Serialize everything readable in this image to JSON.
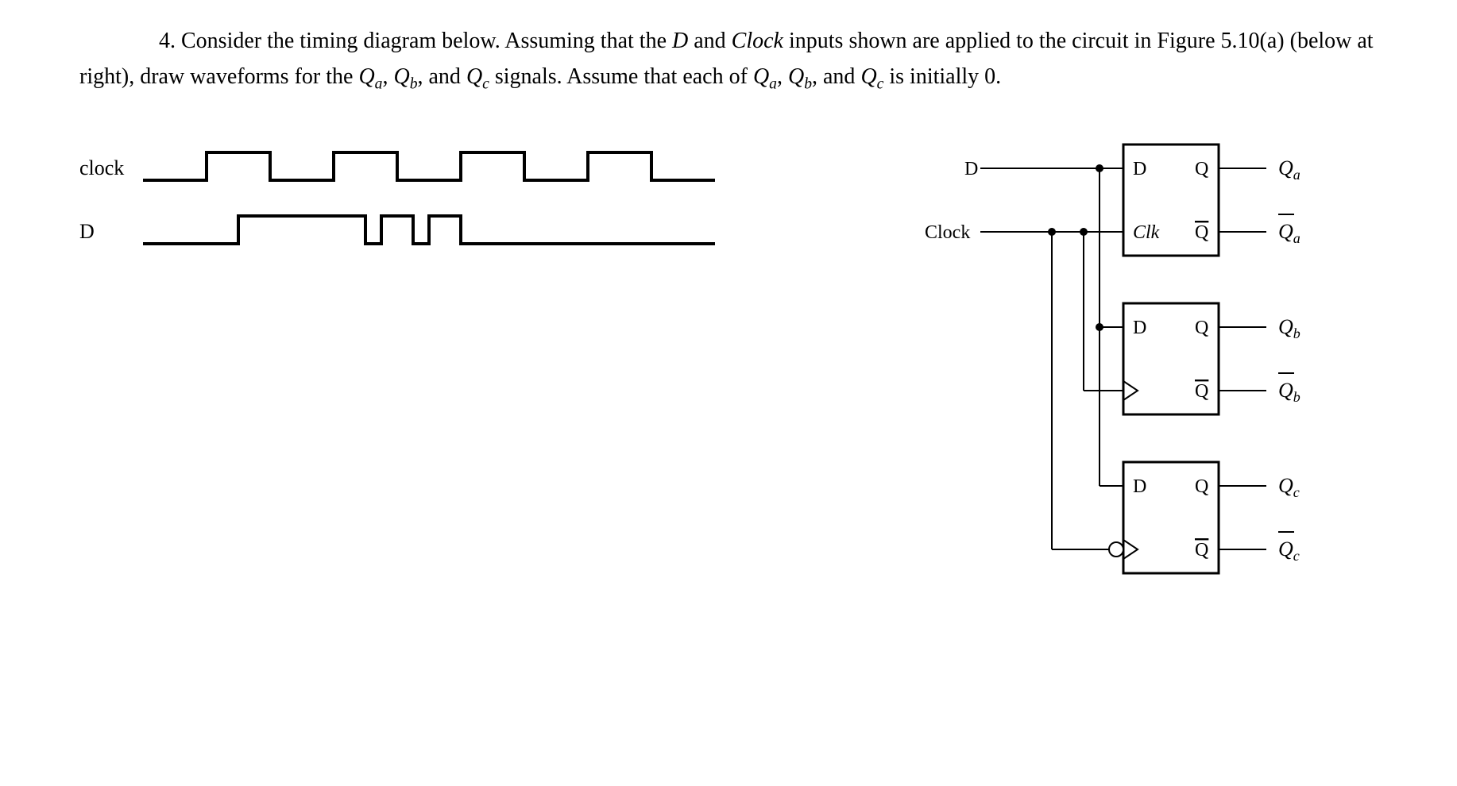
{
  "problem": {
    "number": "4.",
    "text_parts": {
      "p1": "Consider the timing diagram below.  Assuming that the ",
      "D": "D",
      "p2": " and ",
      "Clock": "Clock",
      "p3": " inputs shown are applied to the circuit in Figure 5.10(a) (below at right), draw waveforms for the ",
      "Qa": "Q",
      "a": "a",
      "p4": ", ",
      "Qb": "Q",
      "b": "b",
      "p5": ", and ",
      "Qc": "Q",
      "c": "c",
      "p6": " signals.  Assume that each of ",
      "p7": ", ",
      "p8": ", and ",
      "p9": " is initially 0."
    }
  },
  "timing": {
    "clock_label": "clock",
    "d_label": "D",
    "clock_wave": [
      {
        "t": 0,
        "v": 0
      },
      {
        "t": 80,
        "v": 0
      },
      {
        "t": 80,
        "v": 1
      },
      {
        "t": 160,
        "v": 1
      },
      {
        "t": 160,
        "v": 0
      },
      {
        "t": 240,
        "v": 0
      },
      {
        "t": 240,
        "v": 1
      },
      {
        "t": 320,
        "v": 1
      },
      {
        "t": 320,
        "v": 0
      },
      {
        "t": 400,
        "v": 0
      },
      {
        "t": 400,
        "v": 1
      },
      {
        "t": 480,
        "v": 1
      },
      {
        "t": 480,
        "v": 0
      },
      {
        "t": 560,
        "v": 0
      },
      {
        "t": 560,
        "v": 1
      },
      {
        "t": 640,
        "v": 1
      },
      {
        "t": 640,
        "v": 0
      },
      {
        "t": 720,
        "v": 0
      }
    ],
    "d_wave": [
      {
        "t": 0,
        "v": 0
      },
      {
        "t": 120,
        "v": 0
      },
      {
        "t": 120,
        "v": 1
      },
      {
        "t": 280,
        "v": 1
      },
      {
        "t": 280,
        "v": 0
      },
      {
        "t": 300,
        "v": 0
      },
      {
        "t": 300,
        "v": 1
      },
      {
        "t": 340,
        "v": 1
      },
      {
        "t": 340,
        "v": 0
      },
      {
        "t": 360,
        "v": 0
      },
      {
        "t": 360,
        "v": 1
      },
      {
        "t": 400,
        "v": 1
      },
      {
        "t": 400,
        "v": 0
      },
      {
        "t": 720,
        "v": 0
      }
    ]
  },
  "circuit": {
    "inputs": {
      "D": "D",
      "Clock": "Clock"
    },
    "ff": {
      "D": "D",
      "Q": "Q",
      "Qbar": "Q",
      "Clk": "Clk"
    },
    "outputs": {
      "Qa": "Q",
      "Qa_sub": "a",
      "Qabar": "Q",
      "Qabar_sub": "a",
      "Qb": "Q",
      "Qb_sub": "b",
      "Qbbar": "Q",
      "Qbbar_sub": "b",
      "Qc": "Q",
      "Qc_sub": "c",
      "Qcbar": "Q",
      "Qcbar_sub": "c"
    }
  }
}
